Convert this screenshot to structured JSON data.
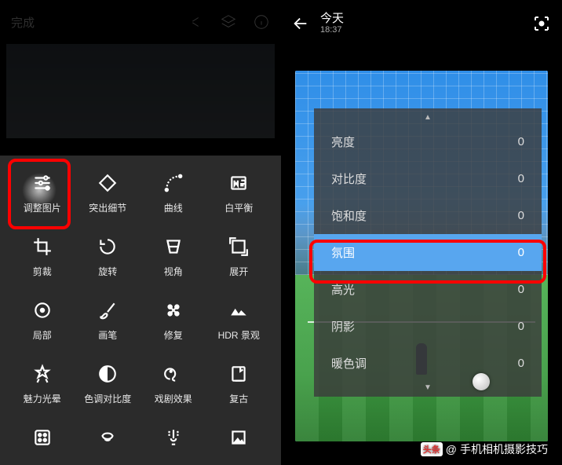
{
  "left": {
    "done_label": "完成",
    "tools": [
      {
        "id": "tune",
        "label": "调整图片"
      },
      {
        "id": "details",
        "label": "突出细节"
      },
      {
        "id": "curves",
        "label": "曲线"
      },
      {
        "id": "wb",
        "label": "白平衡"
      },
      {
        "id": "crop",
        "label": "剪裁"
      },
      {
        "id": "rotate",
        "label": "旋转"
      },
      {
        "id": "perspective",
        "label": "视角"
      },
      {
        "id": "expand",
        "label": "展开"
      },
      {
        "id": "selective",
        "label": "局部"
      },
      {
        "id": "brush",
        "label": "画笔"
      },
      {
        "id": "healing",
        "label": "修复"
      },
      {
        "id": "hdr",
        "label": "HDR 景观"
      },
      {
        "id": "glamour",
        "label": "魅力光晕"
      },
      {
        "id": "tonal",
        "label": "色调对比度"
      },
      {
        "id": "drama",
        "label": "戏剧效果"
      },
      {
        "id": "vintage",
        "label": "复古"
      }
    ]
  },
  "right": {
    "title": "今天",
    "time": "18:37",
    "sliders": [
      {
        "name": "亮度",
        "value": "0"
      },
      {
        "name": "对比度",
        "value": "0"
      },
      {
        "name": "饱和度",
        "value": "0"
      },
      {
        "name": "氛围",
        "value": "0"
      },
      {
        "name": "高光",
        "value": "0"
      },
      {
        "name": "阴影",
        "value": "0"
      },
      {
        "name": "暖色调",
        "value": "0"
      }
    ],
    "active_index": 3
  },
  "watermark": {
    "badge": "头条",
    "at": "@",
    "text": "手机相机摄影技巧"
  }
}
